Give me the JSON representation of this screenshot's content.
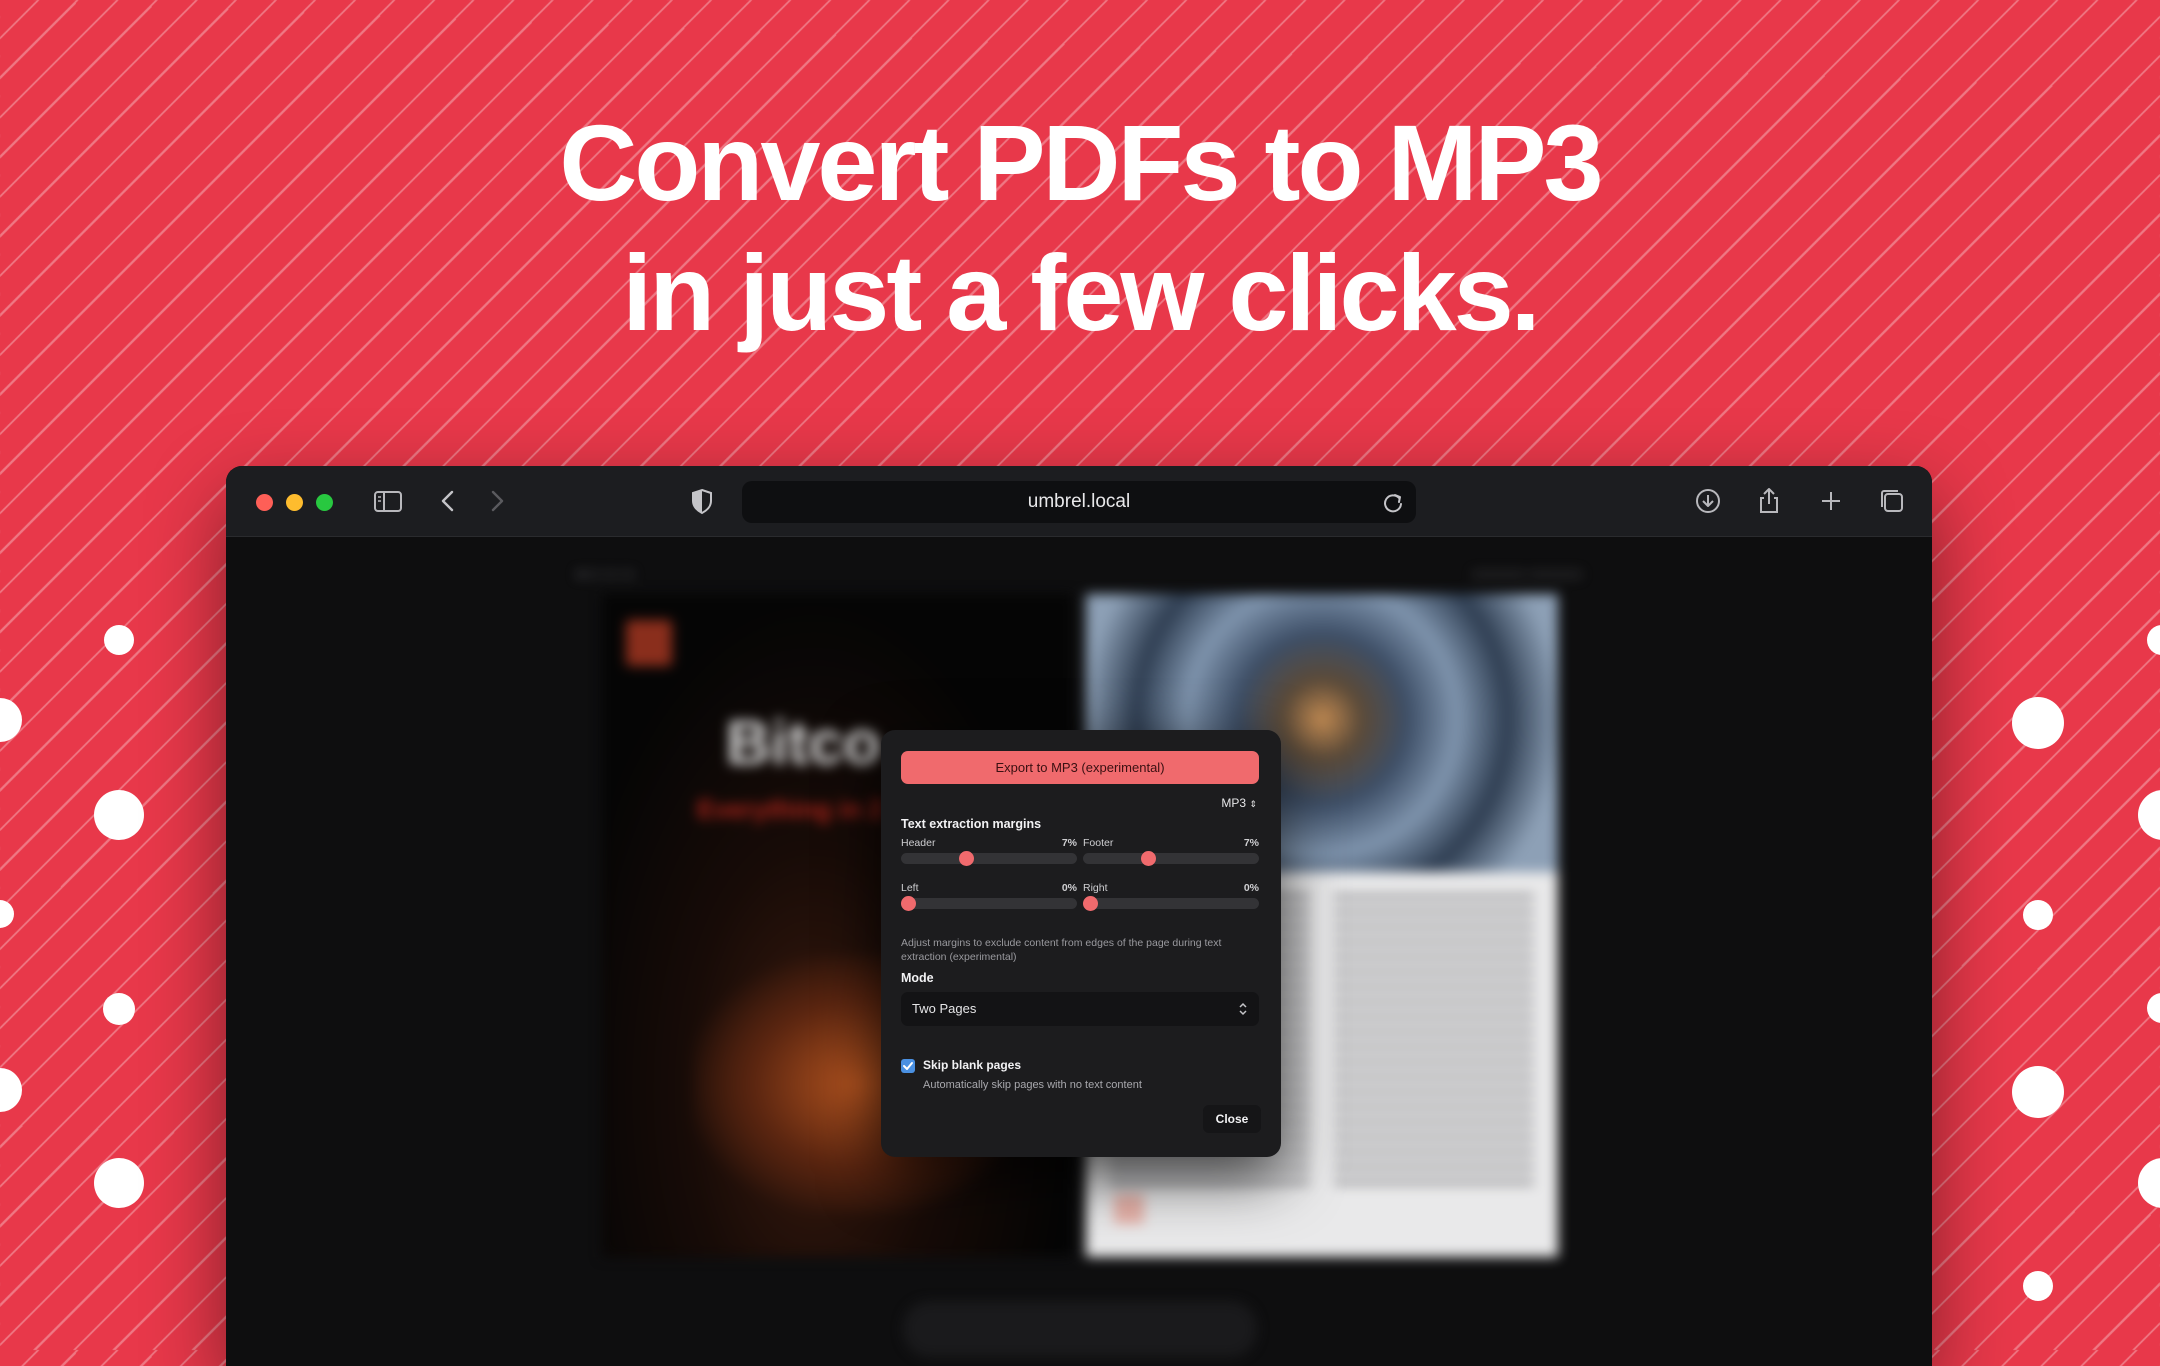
{
  "headline": {
    "line1": "Convert PDFs to MP3",
    "line2": "in just a few clicks."
  },
  "browser": {
    "url": "umbrel.local",
    "icons": {
      "sidebar": "sidebar-icon",
      "back": "chevron-left-icon",
      "forward": "chevron-right-icon",
      "shield": "shield-icon",
      "reload": "reload-icon",
      "download": "download-icon",
      "share": "share-icon",
      "new_tab": "plus-icon",
      "tabs": "tabs-icon"
    }
  },
  "document": {
    "cover_title": "Bitco",
    "cover_subtitle": "Everything in 2"
  },
  "dialog": {
    "export_button": "Export to MP3 (experimental)",
    "format": "MP3",
    "margins_title": "Text extraction margins",
    "margins": {
      "header": {
        "label": "Header",
        "value": "7%",
        "level": 0.37
      },
      "footer": {
        "label": "Footer",
        "value": "7%",
        "level": 0.37
      },
      "left": {
        "label": "Left",
        "value": "0%",
        "level": 0.04
      },
      "right": {
        "label": "Right",
        "value": "0%",
        "level": 0.04
      }
    },
    "hint": "Adjust margins to exclude content from edges of the page during text extraction (experimental)",
    "mode_title": "Mode",
    "mode_value": "Two Pages",
    "skip_label": "Skip blank pages",
    "skip_sub": "Automatically skip pages with no text content",
    "skip_checked": true,
    "close": "Close"
  },
  "colors": {
    "background": "#e8384a",
    "accent": "#f06a6d",
    "window": "#1c1d20"
  }
}
